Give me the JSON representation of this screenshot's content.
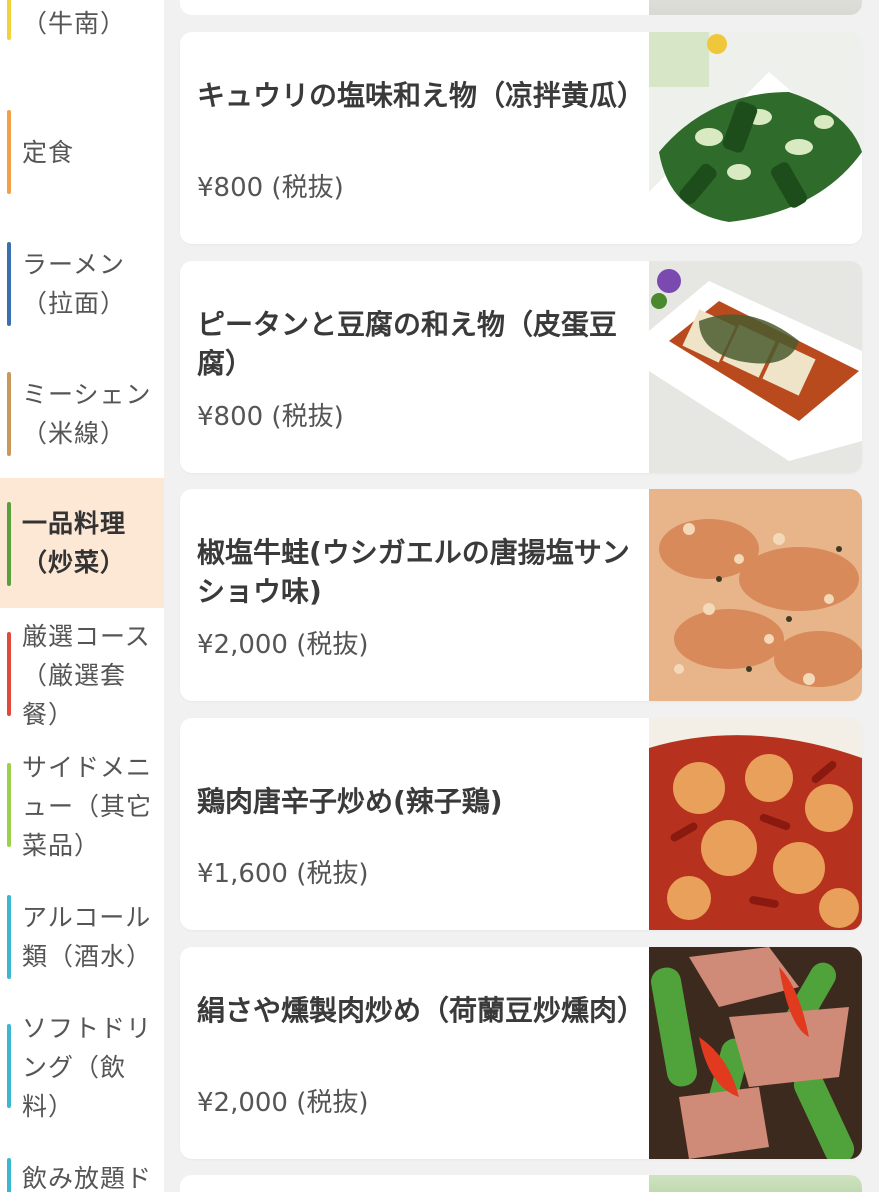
{
  "sidebar": {
    "categories": [
      {
        "label": "小ぶり料理（牛南）",
        "shown": "（牛南）",
        "bar_color": "#f2d23a",
        "active": false
      },
      {
        "label": "定食",
        "bar_color": "#f0a04a",
        "active": false
      },
      {
        "label": "ラーメン（拉面）",
        "bar_color": "#3a6fb0",
        "active": false
      },
      {
        "label": "ミーシェン（米線）",
        "bar_color": "#c8995a",
        "active": false
      },
      {
        "label": "一品料理（炒菜）",
        "bar_color": "#5aa03a",
        "active": true
      },
      {
        "label": "厳選コース（厳選套餐）",
        "bar_color": "#e04a3a",
        "active": false
      },
      {
        "label": "サイドメニュー（其它菜品）",
        "bar_color": "#9ad04a",
        "active": false
      },
      {
        "label": "アルコール類（酒水）",
        "bar_color": "#3ab8d0",
        "active": false
      },
      {
        "label": "ソフトドリング（飲料）",
        "bar_color": "#3ab8d0",
        "active": false
      },
      {
        "label": "飲み放題ド",
        "bar_color": "#3ab8d0",
        "active": false
      }
    ]
  },
  "menu": {
    "items": [
      {
        "name": "キュウリの塩味和え物（凉拌黄瓜）",
        "price": "¥800 (税抜)",
        "photo_icon": "cucumber-salad-photo"
      },
      {
        "name": "ピータンと豆腐の和え物（皮蛋豆腐）",
        "price": "¥800 (税抜)",
        "photo_icon": "century-egg-tofu-photo"
      },
      {
        "name": "椒塩牛蛙(ウシガエルの唐揚塩サンショウ味)",
        "price": "¥2,000 (税抜)",
        "photo_icon": "fried-bullfrog-photo"
      },
      {
        "name": "鶏肉唐辛子炒め(辣子鶏)",
        "price": "¥1,600 (税抜)",
        "photo_icon": "spicy-chicken-photo"
      },
      {
        "name": "絹さや燻製肉炒め（荷蘭豆炒燻肉）",
        "price": "¥2,000 (税抜)",
        "photo_icon": "snow-pea-pork-photo"
      }
    ]
  },
  "colors": {
    "active_bg": "#fde8d6",
    "page_bg": "#f1f1f1"
  }
}
